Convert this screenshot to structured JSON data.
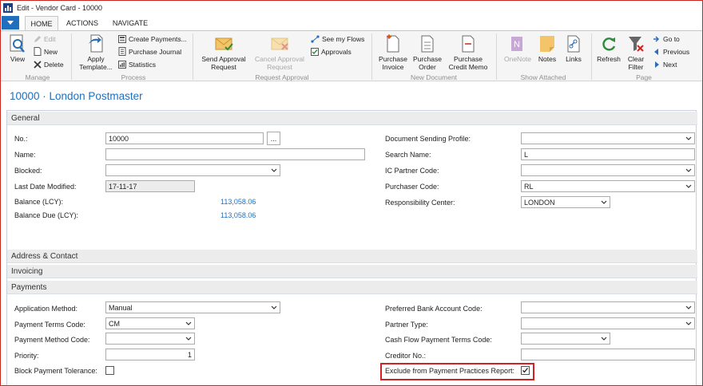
{
  "window": {
    "title": "Edit - Vendor Card - 10000"
  },
  "tabs": {
    "home": "HOME",
    "actions": "ACTIONS",
    "navigate": "NAVIGATE"
  },
  "ribbon": {
    "manage": {
      "label": "Manage",
      "view": "View",
      "edit": "Edit",
      "new": "New",
      "delete": "Delete"
    },
    "process": {
      "label": "Process",
      "apply_template_1": "Apply",
      "apply_template_2": "Template...",
      "create_payments": "Create Payments...",
      "purchase_journal": "Purchase Journal",
      "statistics": "Statistics"
    },
    "request_approval": {
      "label": "Request Approval",
      "send_1": "Send Approval",
      "send_2": "Request",
      "cancel_1": "Cancel Approval",
      "cancel_2": "Request",
      "see_flows": "See my Flows",
      "approvals": "Approvals"
    },
    "new_document": {
      "label": "New Document",
      "invoice_1": "Purchase",
      "invoice_2": "Invoice",
      "order_1": "Purchase",
      "order_2": "Order",
      "credit_1": "Purchase",
      "credit_2": "Credit Memo"
    },
    "show_attached": {
      "label": "Show Attached",
      "onenote": "OneNote",
      "notes": "Notes",
      "links": "Links"
    },
    "page": {
      "label": "Page",
      "refresh": "Refresh",
      "clear_1": "Clear",
      "clear_2": "Filter",
      "goto": "Go to",
      "previous": "Previous",
      "next": "Next"
    }
  },
  "page_title": "10000 · London Postmaster",
  "general": {
    "header": "General",
    "no_label": "No.:",
    "no_value": "10000",
    "assist": "...",
    "name_label": "Name:",
    "name_value": "",
    "blocked_label": "Blocked:",
    "blocked_value": "",
    "last_modified_label": "Last Date Modified:",
    "last_modified_value": "17-11-17",
    "balance_label": "Balance (LCY):",
    "balance_value": "113,058.06",
    "balance_due_label": "Balance Due (LCY):",
    "balance_due_value": "113,058.06",
    "doc_sending_label": "Document Sending Profile:",
    "doc_sending_value": "",
    "search_name_label": "Search Name:",
    "search_name_value": "L",
    "ic_partner_label": "IC Partner Code:",
    "ic_partner_value": "",
    "purchaser_label": "Purchaser Code:",
    "purchaser_value": "RL",
    "resp_center_label": "Responsibility Center:",
    "resp_center_value": "LONDON"
  },
  "address_header": "Address & Contact",
  "invoicing_header": "Invoicing",
  "payments": {
    "header": "Payments",
    "app_method_label": "Application Method:",
    "app_method_value": "Manual",
    "terms_label": "Payment Terms Code:",
    "terms_value": "CM",
    "method_label": "Payment Method Code:",
    "method_value": "",
    "priority_label": "Priority:",
    "priority_value": "1",
    "block_tol_label": "Block Payment Tolerance:",
    "pref_bank_label": "Preferred Bank Account Code:",
    "pref_bank_value": "",
    "partner_type_label": "Partner Type:",
    "partner_type_value": "",
    "cashflow_label": "Cash Flow Payment Terms Code:",
    "cashflow_value": "",
    "creditor_label": "Creditor No.:",
    "creditor_value": "",
    "exclude_label": "Exclude from Payment Practices Report:"
  },
  "colors": {
    "accent": "#1f6fbf",
    "highlight": "#d42222"
  }
}
